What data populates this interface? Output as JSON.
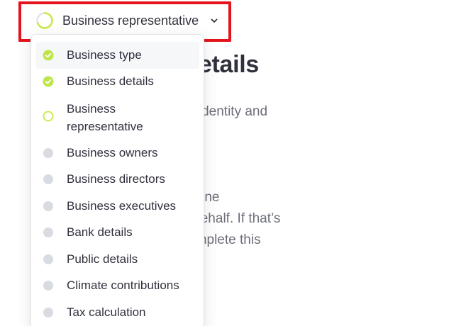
{
  "trigger": {
    "label": "Business representative",
    "progress_icon": "progress-ring-icon",
    "chevron_icon": "chevron-down-icon"
  },
  "background": {
    "heading": "rsonal details",
    "subtitle": "n to verify your identity and",
    "paragraph_lines": [
      "ivated by someone",
      "organization’s behalf. If that’s",
      "ht person to complete this"
    ]
  },
  "menu": {
    "items": [
      {
        "label": "Business type",
        "status": "complete"
      },
      {
        "label": "Business details",
        "status": "complete"
      },
      {
        "label": "Business representative",
        "status": "current"
      },
      {
        "label": "Business owners",
        "status": "pending"
      },
      {
        "label": "Business directors",
        "status": "pending"
      },
      {
        "label": "Business executives",
        "status": "pending"
      },
      {
        "label": "Bank details",
        "status": "pending"
      },
      {
        "label": "Public details",
        "status": "pending"
      },
      {
        "label": "Climate contributions",
        "status": "pending"
      },
      {
        "label": "Tax calculation",
        "status": "pending"
      }
    ]
  },
  "colors": {
    "complete": "#bee54a",
    "current_ring": "#c9ec4c",
    "pending": "#d8dbe1",
    "highlight": "#e3141c",
    "text": "#30313d",
    "muted_text": "#6c6e7a"
  }
}
